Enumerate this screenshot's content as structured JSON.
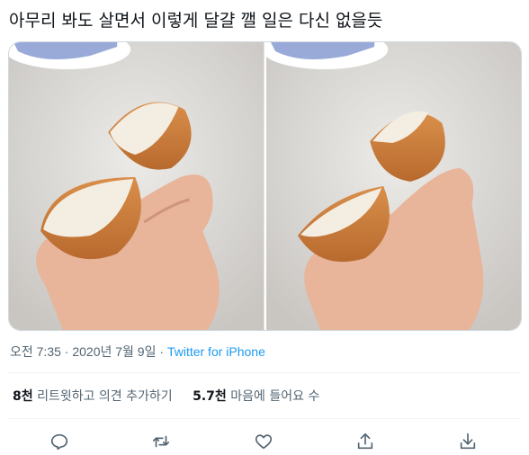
{
  "tweet": {
    "text": "아무리 봐도 살면서 이렇게 달걀 깰 일은 다신 없을듯",
    "date": "오전 7:35 · 2020년 7월 9일",
    "separator": " · ",
    "source": "Twitter for iPhone"
  },
  "stats": {
    "retweets_count": "8천",
    "retweets_label": "리트윗하고 의견 추가하기",
    "likes_count": "5.7천",
    "likes_label": "마음에 들어요 수"
  },
  "colors": {
    "link": "#1d9bf0",
    "muted": "#536471",
    "divider": "#eff3f4",
    "icon": "#536471"
  },
  "icons": [
    "reply-icon",
    "retweet-icon",
    "like-icon",
    "share-icon",
    "bookmark-download-icon"
  ]
}
